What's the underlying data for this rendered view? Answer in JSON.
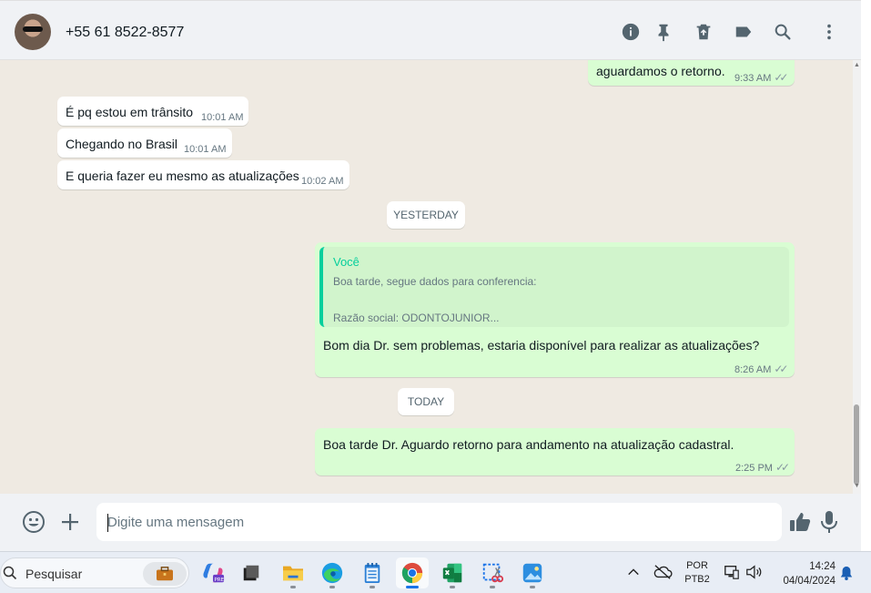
{
  "header": {
    "contact_name": "+55 61 8522-8577",
    "icons": [
      "info-icon",
      "pin-icon",
      "delete-icon",
      "label-icon",
      "search-icon",
      "menu-icon"
    ]
  },
  "messages": [
    {
      "direction": "out",
      "text": "aguardamos o retorno.",
      "time": "9:33 AM",
      "status": "read"
    },
    {
      "direction": "in",
      "text": "É pq estou em trânsito",
      "time": "10:01 AM"
    },
    {
      "direction": "in",
      "text": "Chegando no Brasil",
      "time": "10:01 AM"
    },
    {
      "direction": "in",
      "text": "E queria fazer eu mesmo as atualizações",
      "time": "10:02 AM"
    }
  ],
  "date_separators": {
    "yesterday": "YESTERDAY",
    "today": "TODAY"
  },
  "reply_message": {
    "quote_author": "Você",
    "quote_line_1": "Boa tarde, segue dados para conferencia:",
    "quote_line_2": "Razão social: ODONTOJUNIOR...",
    "text": "Bom dia Dr. sem problemas, estaria disponível para realizar as atualizações?",
    "time": "8:26 AM"
  },
  "today_message": {
    "text": "Boa tarde Dr. Aguardo retorno para andamento na atualização cadastral.",
    "time": "2:25 PM"
  },
  "composer": {
    "placeholder": "Digite uma mensagem"
  },
  "taskbar": {
    "search_text": "Pesquisar",
    "apps": [
      "copilot",
      "task-view",
      "file-explorer",
      "edge",
      "notepad",
      "chrome",
      "excel",
      "snipping-tool",
      "photos"
    ],
    "language_line1": "POR",
    "language_line2": "PTB2",
    "time": "14:24",
    "date": "04/04/2024"
  },
  "colors": {
    "outgoing_bubble": "#d9fdd3",
    "incoming_bubble": "#ffffff",
    "quote_accent": "#06cf9c",
    "chat_background": "#efeae2"
  }
}
